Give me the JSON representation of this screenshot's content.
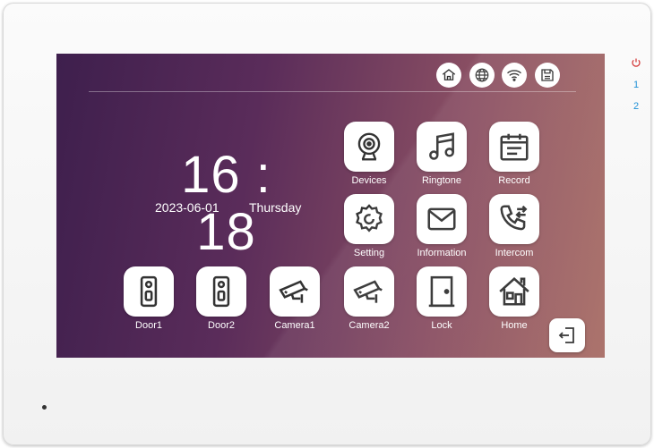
{
  "clock": {
    "time": "16 : 18",
    "date": "2023-06-01",
    "weekday": "Thursday"
  },
  "status_icons": [
    "home-icon",
    "globe-icon",
    "wifi-icon",
    "save-icon"
  ],
  "apps": [
    {
      "label": "Devices",
      "icon": "webcam-icon"
    },
    {
      "label": "Ringtone",
      "icon": "music-note-icon"
    },
    {
      "label": "Record",
      "icon": "calendar-icon"
    },
    {
      "label": "Setting",
      "icon": "settings-icon"
    },
    {
      "label": "Information",
      "icon": "envelope-icon"
    },
    {
      "label": "Intercom",
      "icon": "phone-transfer-icon"
    },
    {
      "label": "Door1",
      "icon": "doorbell-icon"
    },
    {
      "label": "Door2",
      "icon": "doorbell-icon"
    },
    {
      "label": "Camera1",
      "icon": "cctv-camera-icon"
    },
    {
      "label": "Camera2",
      "icon": "cctv-camera-icon"
    },
    {
      "label": "Lock",
      "icon": "door-icon"
    },
    {
      "label": "Home",
      "icon": "house-icon"
    }
  ],
  "side_buttons": {
    "indicator_1": "1",
    "indicator_2": "2"
  },
  "colors": {
    "icon": "#333333",
    "power_led": "#d23030",
    "indicator": "#1e90d6"
  }
}
